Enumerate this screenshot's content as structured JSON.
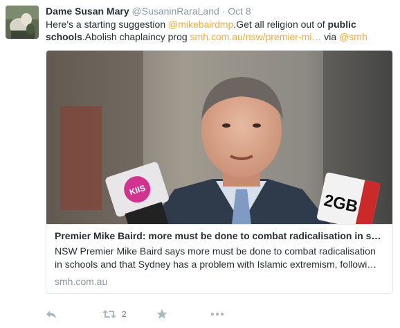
{
  "tweet": {
    "display_name": "Dame Susan Mary",
    "handle": "@SusaninRaraLand",
    "separator": "·",
    "time": "Oct 8",
    "text_parts": {
      "t1": "Here's a starting suggestion ",
      "mention1": "@mikebairdmp",
      "t2": ".Get all religion out of ",
      "bold1": "public schools",
      "t3": ".Abolish chaplaincy prog ",
      "url": "smh.com.au/nsw/premier-mi…",
      "t4": " via ",
      "mention2": "@smh"
    }
  },
  "card": {
    "title": "Premier Mike Baird: more must be done to combat radicalisation in s…",
    "description_line1": "NSW Premier Mike Baird says more must be done to combat radicalisation",
    "description_line2": "in schools and that Sydney has a problem with Islamic extremism, followi…",
    "domain": "smh.com.au",
    "image_mic_left_label": "KIIS",
    "image_mic_right_label": "2GB"
  },
  "actions": {
    "retweet_count": "2"
  },
  "colors": {
    "link": "#f5ab35",
    "muted": "#8899a6",
    "icon": "#aab8c2"
  }
}
